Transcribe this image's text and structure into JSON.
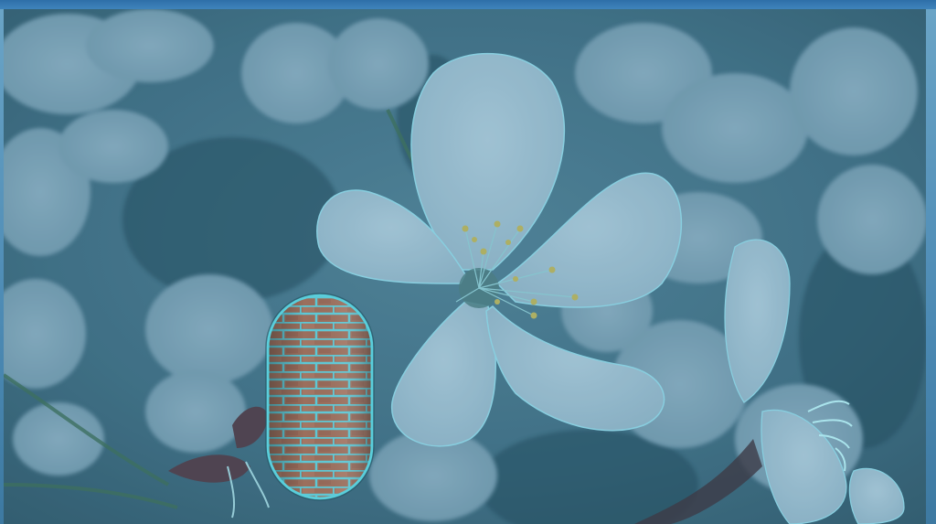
{
  "scene": {
    "subject": "cherry-blossom",
    "object": "brick-capsule"
  },
  "colors": {
    "tint": "#5c93aa",
    "petal": "#9fc0d2",
    "petal_edge": "#8fd6e6",
    "shadow": "#1f4556",
    "stamen": "#b9b35a",
    "brick": "#a46a52",
    "mortar": "#58c8d6",
    "frame_blue": "#2e6fa8"
  }
}
